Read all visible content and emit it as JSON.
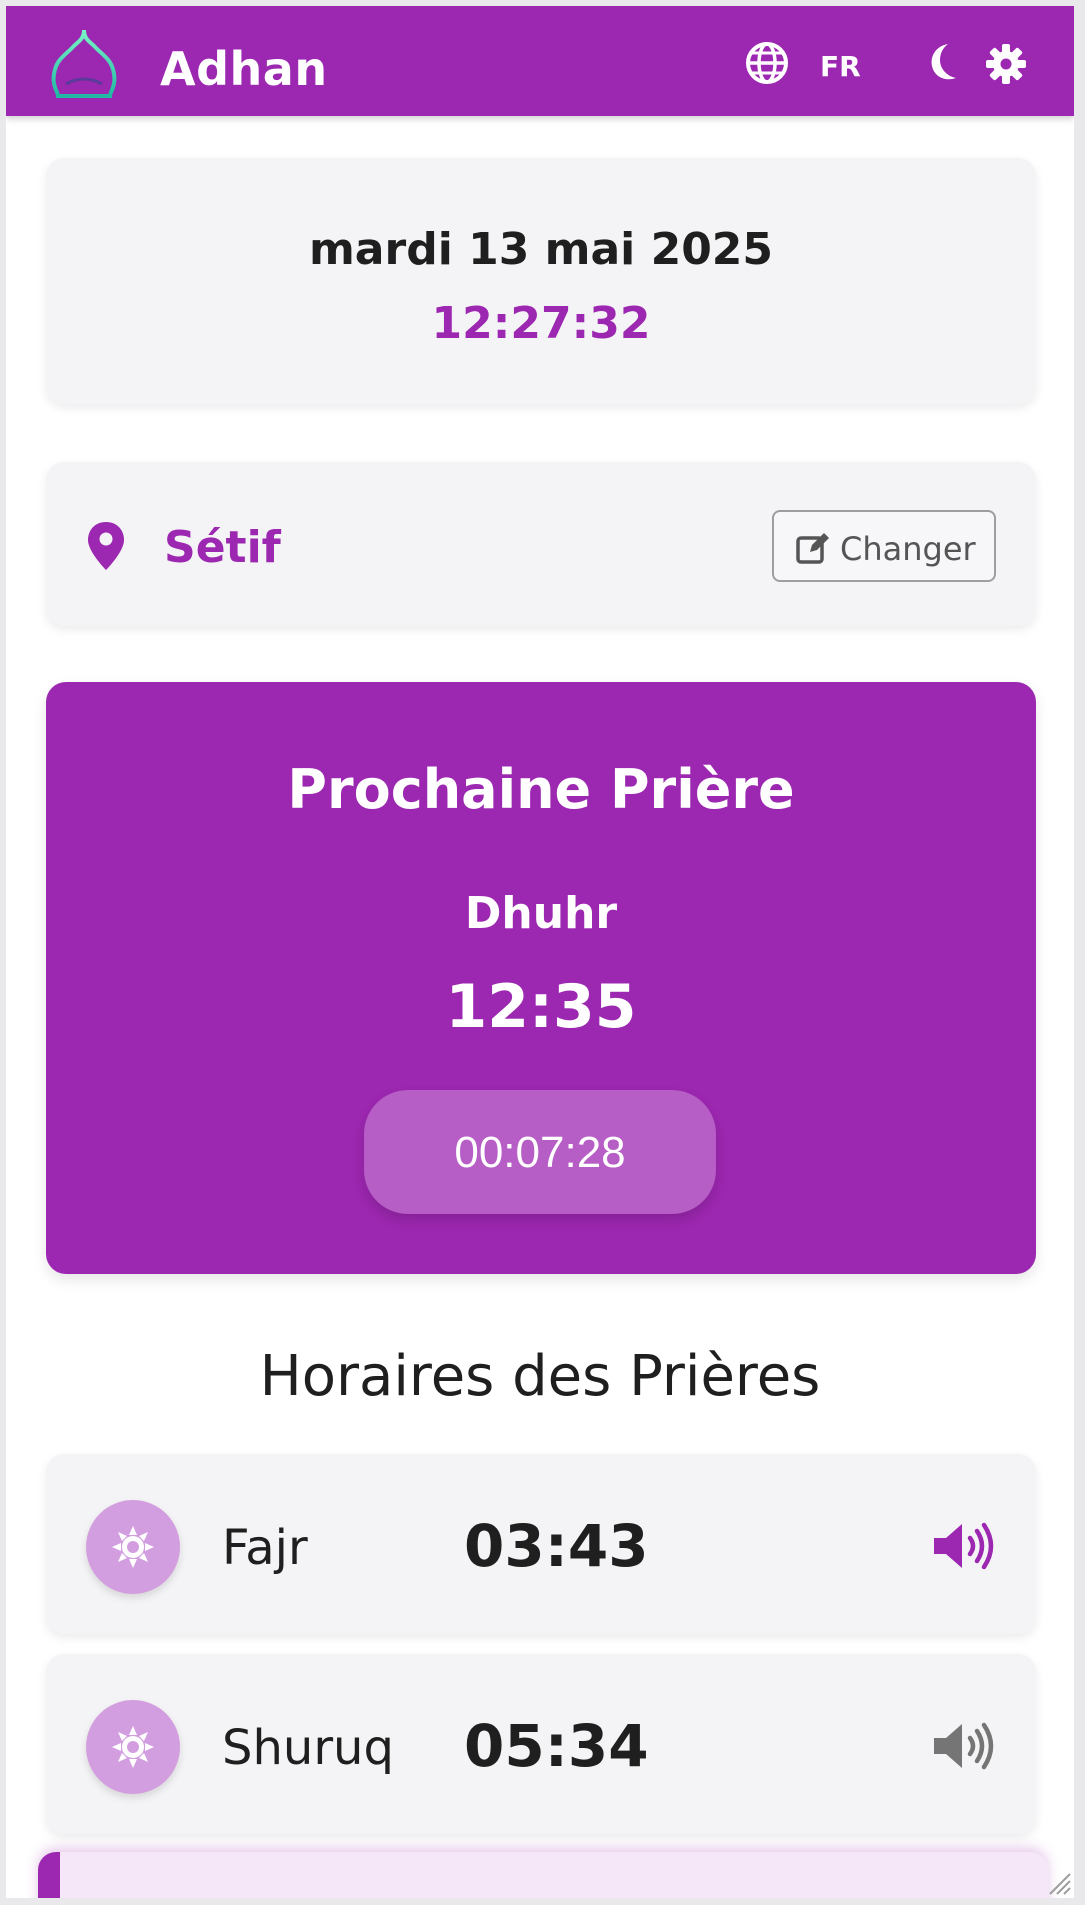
{
  "header": {
    "title": "Adhan",
    "language": "FR",
    "brand_color": "#9c27b0",
    "icons": [
      "mosque-logo",
      "globe-icon",
      "moon-icon",
      "gear-icon"
    ]
  },
  "date_card": {
    "date": "mardi 13 mai 2025",
    "time": "12:27:32"
  },
  "location": {
    "city": "Sétif",
    "change_label": "Changer"
  },
  "next_prayer": {
    "heading": "Prochaine Prière",
    "name": "Dhuhr",
    "time": "12:35",
    "countdown": "00:07:28"
  },
  "schedule": {
    "heading": "Horaires des Prières",
    "prayers": [
      {
        "name": "Fajr",
        "time": "03:43",
        "sound_on": true
      },
      {
        "name": "Shuruq",
        "time": "05:34",
        "sound_on": false
      }
    ]
  }
}
